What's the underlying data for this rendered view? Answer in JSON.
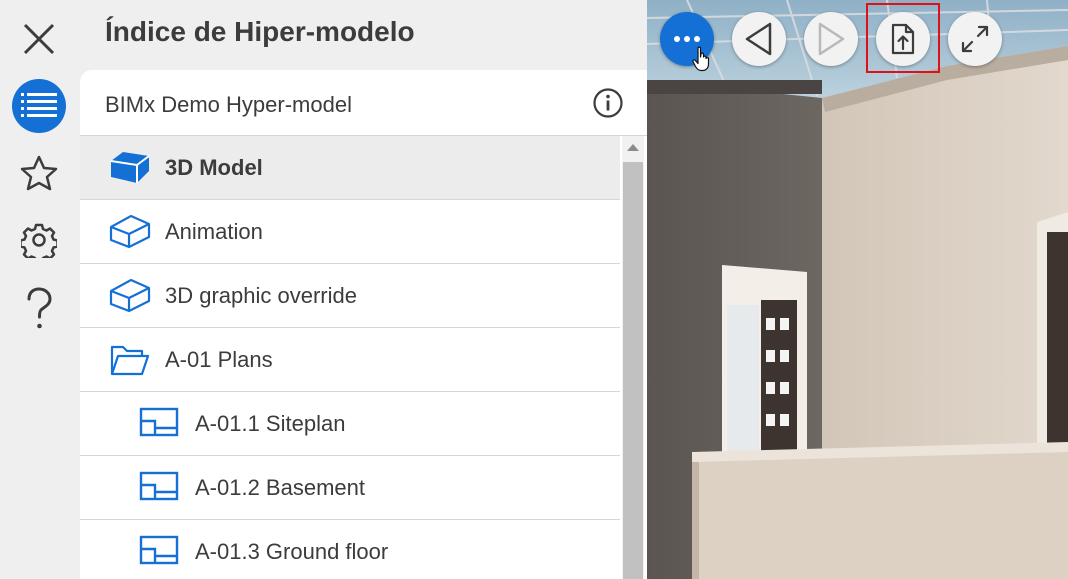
{
  "panel": {
    "title": "Índice de Hiper-modelo",
    "model_name": "BIMx Demo Hyper-model"
  },
  "rail": {
    "items": [
      {
        "icon": "close-icon"
      },
      {
        "icon": "list-icon",
        "active": true
      },
      {
        "icon": "star-icon"
      },
      {
        "icon": "gear-icon"
      },
      {
        "icon": "help-icon"
      }
    ]
  },
  "list": {
    "items": [
      {
        "label": "3D Model",
        "icon": "cube-filled-icon",
        "selected": true,
        "indent": 0
      },
      {
        "label": "Animation",
        "icon": "cube-outline-icon",
        "indent": 0
      },
      {
        "label": "3D graphic override",
        "icon": "cube-outline-icon",
        "indent": 0
      },
      {
        "label": "A-01 Plans",
        "icon": "folder-icon",
        "indent": 0
      },
      {
        "label": "A-01.1 Siteplan",
        "icon": "plan-sheet-icon",
        "indent": 1
      },
      {
        "label": "A-01.2 Basement",
        "icon": "plan-sheet-icon",
        "indent": 1
      },
      {
        "label": "A-01.3 Ground floor",
        "icon": "plan-sheet-icon",
        "indent": 1
      }
    ]
  },
  "toolbar": {
    "buttons": [
      "more-icon",
      "back-icon",
      "forward-icon",
      "share-icon",
      "fullscreen-icon"
    ]
  },
  "colors": {
    "accent": "#1570d6",
    "highlight": "#e0101a"
  }
}
